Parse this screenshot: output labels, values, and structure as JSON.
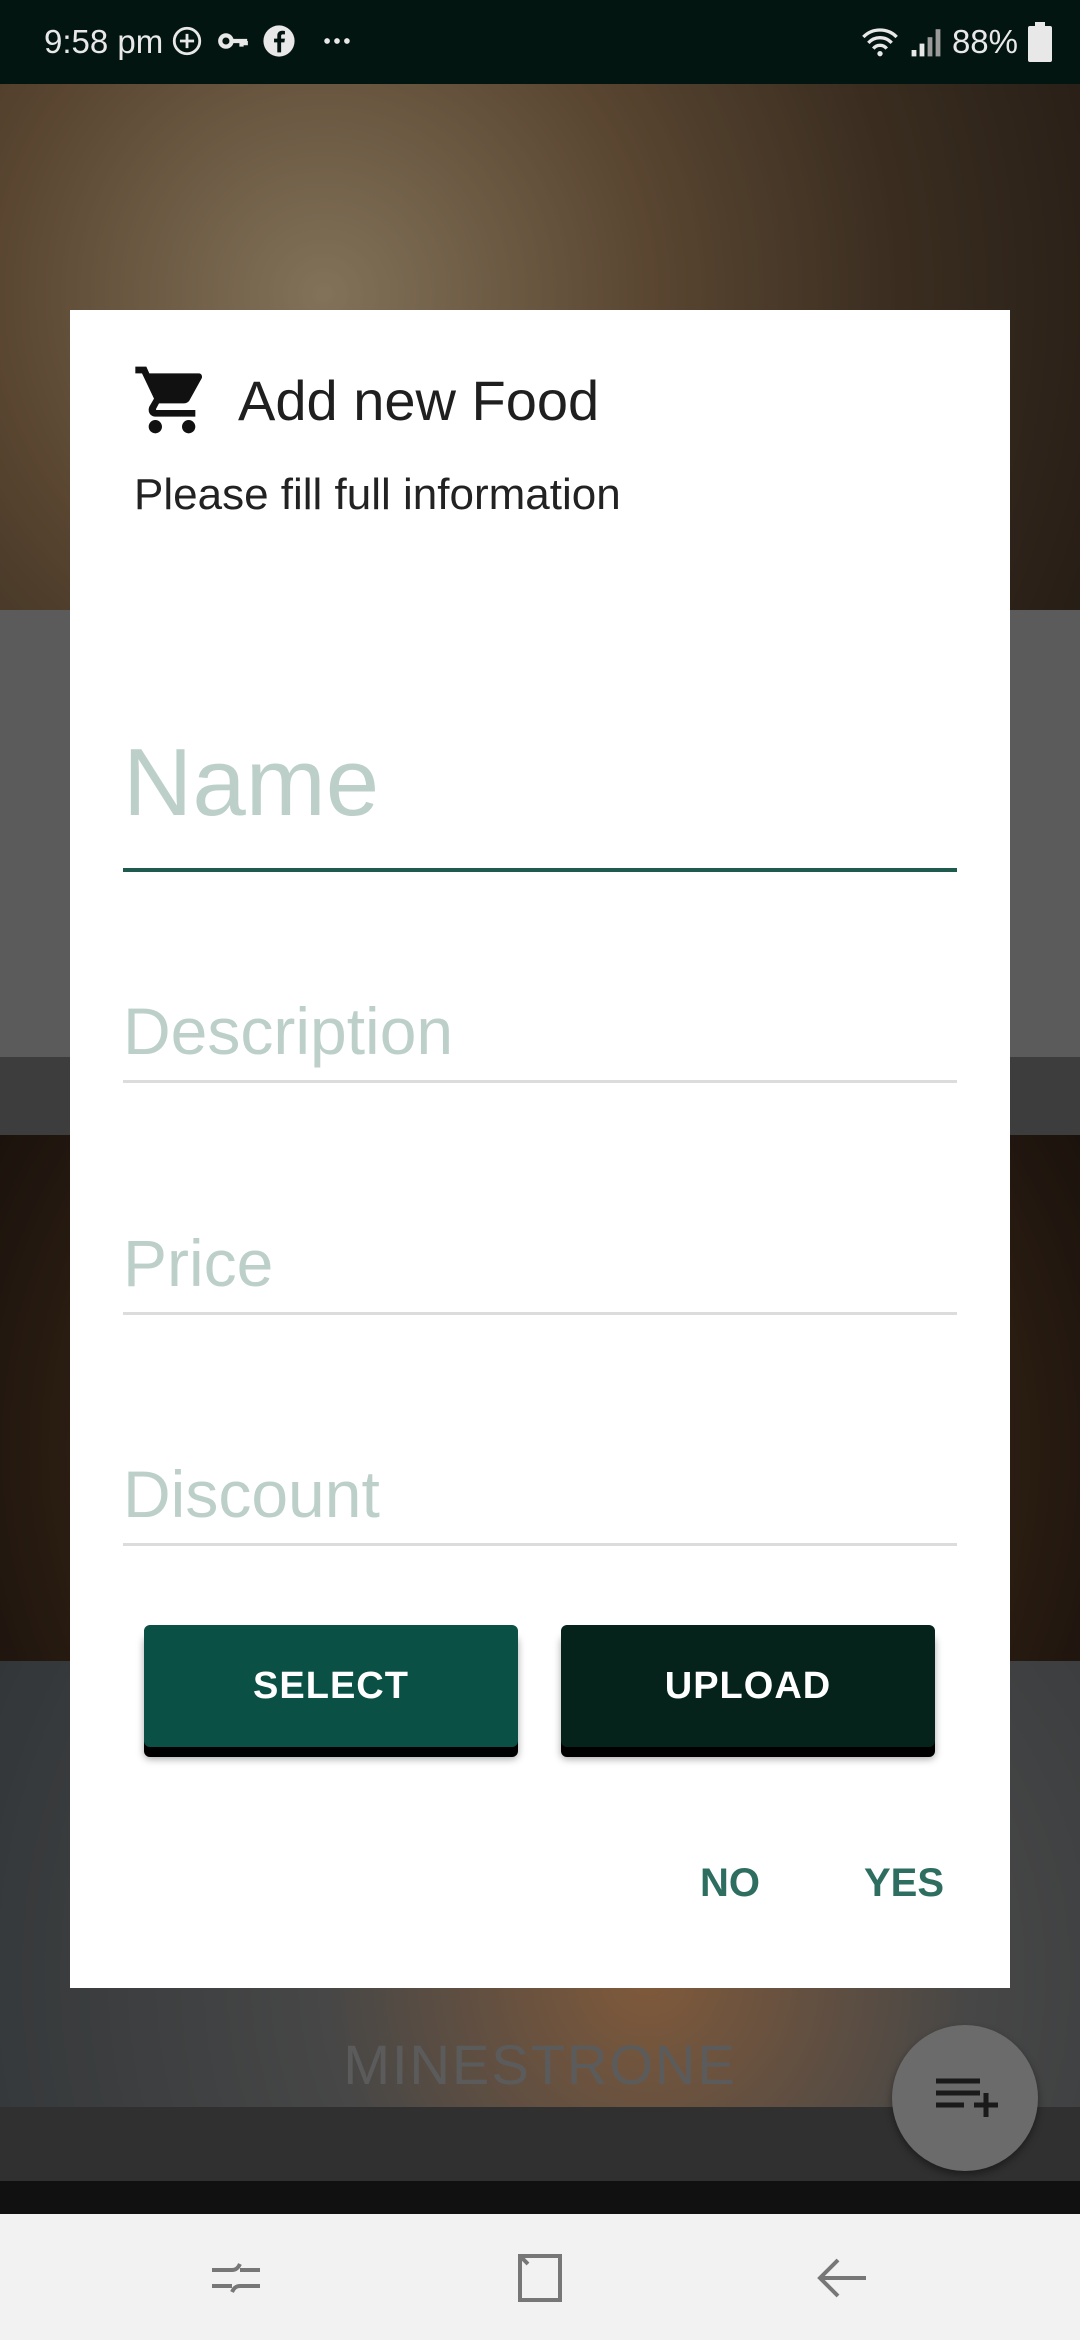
{
  "status_bar": {
    "time": "9:58 pm",
    "battery": "88%",
    "icons": [
      "add-circle-icon",
      "key-icon",
      "facebook-icon",
      "more-dots-icon",
      "wifi-icon",
      "signal-icon",
      "battery-icon"
    ]
  },
  "background": {
    "label": "MINESTRONE"
  },
  "dialog": {
    "icon": "cart-icon",
    "title": "Add new Food",
    "message": "Please fill full information",
    "fields": {
      "name_placeholder": "Name",
      "description_placeholder": "Description",
      "price_placeholder": "Price",
      "discount_placeholder": "Discount"
    },
    "buttons": {
      "select": "SELECT",
      "upload": "UPLOAD",
      "no": "NO",
      "yes": "YES"
    }
  },
  "fab": {
    "icon": "playlist-add-icon"
  },
  "nav_bar": {
    "icons": [
      "recents-icon",
      "home-icon",
      "back-icon"
    ]
  },
  "colors": {
    "accent": "#0a5045",
    "dark_button": "#05231b",
    "action_text": "#2e6e60",
    "status_bar": "#031511"
  }
}
